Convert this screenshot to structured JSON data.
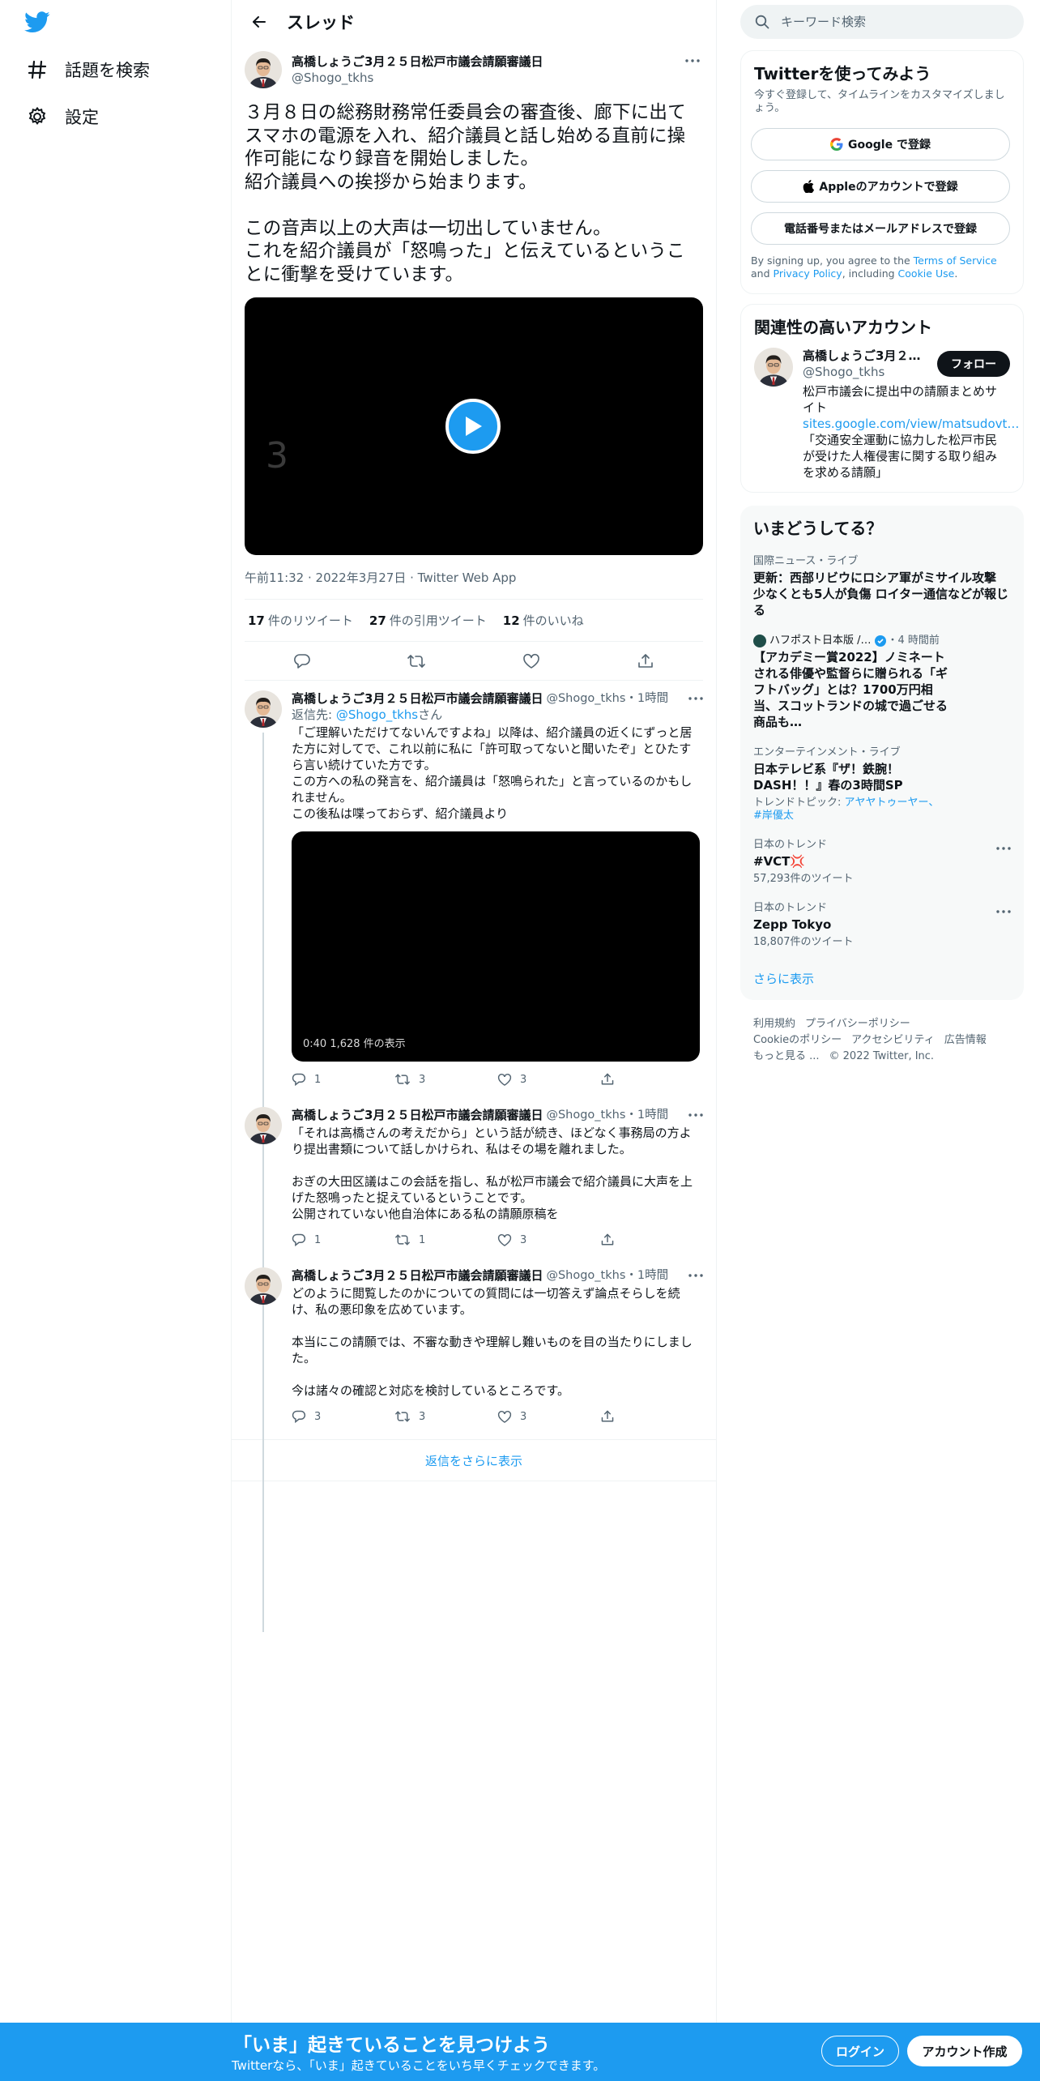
{
  "nav": {
    "logo_icon": "twitter-bird-icon",
    "items": [
      {
        "label": "話題を検索",
        "icon": "hashtag-icon"
      },
      {
        "label": "設定",
        "icon": "gear-icon"
      }
    ]
  },
  "header": {
    "title": "スレッド"
  },
  "tweet": {
    "name": "高橋しょうご3月２５日松戸市議会請願審議日",
    "handle": "@Shogo_tkhs",
    "text": "３月８日の総務財務常任委員会の審査後、廊下に出てスマホの電源を入れ、紹介議員と話し始める直前に操作可能になり録音を開始しました。\n紹介議員への挨拶から始まります。\n\nこの音声以上の大声は一切出していません。\nこれを紹介議員が「怒鳴った」と伝えているということに衝撃を受けています。",
    "video_countdown": "3",
    "meta": "午前11:32 · 2022年3月27日 · Twitter Web App",
    "stats": [
      {
        "count": "17",
        "label": "件のリツイート"
      },
      {
        "count": "27",
        "label": "件の引用ツイート"
      },
      {
        "count": "12",
        "label": "件のいいね"
      }
    ]
  },
  "replies": [
    {
      "name": "高橋しょうご3月２５日松戸市議会請願審議日",
      "handle": "@Shogo_tkhs",
      "time": "・1時間",
      "replying_prefix": "返信先: ",
      "replying_handle": "@Shogo_tkhs",
      "replying_suffix": "さん",
      "text": "「ご理解いただけてないんですよね」以降は、紹介議員の近くにずっと居た方に対してで、これ以前に私に「許可取ってないと聞いたぞ」とひたすら言い続けていた方です。\nこの方への私の発言を、紹介議員は「怒鳴られた」と言っているのかもしれません。\nこの後私は喋っておらず、紹介議員より",
      "video_info": "0:40   1,628 件の表示",
      "counts": {
        "reply": "1",
        "retweet": "3",
        "like": "3"
      }
    },
    {
      "name": "高橋しょうご3月２５日松戸市議会請願審議日",
      "handle": "@Shogo_tkhs",
      "time": "・1時間",
      "text": "「それは高橋さんの考えだから」という話が続き、ほどなく事務局の方より提出書類について話しかけられ、私はその場を離れました。\n\nおぎの大田区議はこの会話を指し、私が松戸市議会で紹介議員に大声を上げた怒鳴ったと捉えているということです。\n公開されていない他自治体にある私の請願原稿を",
      "counts": {
        "reply": "1",
        "retweet": "1",
        "like": "3"
      }
    },
    {
      "name": "高橋しょうご3月２５日松戸市議会請願審議日",
      "handle": "@Shogo_tkhs",
      "time": "・1時間",
      "text": "どのように閲覧したのかについての質問には一切答えず論点そらしを続け、私の悪印象を広めています。\n\n本当にこの請願では、不審な動きや理解し難いものを目の当たりにしました。\n\n今は諸々の確認と対応を検討しているところです。",
      "counts": {
        "reply": "3",
        "retweet": "3",
        "like": "3"
      }
    }
  ],
  "show_more_replies": "返信をさらに表示",
  "search": {
    "placeholder": "キーワード検索"
  },
  "signup": {
    "title": "Twitterを使ってみよう",
    "subtitle": "今すぐ登録して、タイムラインをカスタマイズしましょう。",
    "google": "Google で登録",
    "apple": "Appleのアカウントで登録",
    "phone": "電話番号またはメールアドレスで登録",
    "tos_1": "By signing up, you agree to the ",
    "tos_link1": "Terms of Service",
    "tos_2": " and ",
    "tos_link2": "Privacy Policy",
    "tos_3": ", including ",
    "tos_link3": "Cookie Use",
    "tos_4": "."
  },
  "related": {
    "title": "関連性の高いアカウント",
    "name": "高橋しょうご3月２５日松戸市議会請願審議日",
    "handle": "@Shogo_tkhs",
    "follow": "フォロー",
    "bio_1": "松戸市議会に提出中の請願まとめサイト ",
    "bio_link": "sites.google.com/view/matsudovt…",
    "bio_2": "「交通安全運動に協力した松戸市民が受けた人権侵害に関する取り組みを求める請願」"
  },
  "trends": {
    "title": "いまどうしてる？",
    "items": [
      {
        "category": "国際ニュース・ライブ",
        "title": "更新：西部リビウにロシア軍がミサイル攻撃 少なくとも5人が負傷 ロイター通信などが報じる"
      },
      {
        "source": "ハフポスト日本版 /…",
        "time": "・4 時間前",
        "title": "【アカデミー賞2022】ノミネートされる俳優や監督らに贈られる「ギフトバッグ」とは？1700万円相当、スコットランドの城で過ごせる商品も…"
      },
      {
        "category": "エンターテインメント・ライブ",
        "title": "日本テレビ系『ザ！鉄腕！DASH！！』春の3時間SP",
        "topics_prefix": "トレンドトピック: ",
        "topics": "アヤヤトゥーヤー、#岸優太"
      },
      {
        "category": "日本のトレンド",
        "title": "#VCT💢",
        "count": "57,293件のツイート"
      },
      {
        "category": "日本のトレンド",
        "title": "Zepp Tokyo",
        "count": "18,807件のツイート"
      }
    ],
    "show_more": "さらに表示"
  },
  "footer": {
    "links_row1": [
      "利用規約",
      "プライバシーポリシー"
    ],
    "links_row2": [
      "Cookieのポリシー",
      "アクセシビリティ",
      "広告情報"
    ],
    "more": "もっと見る ...",
    "copyright": "© 2022 Twitter, Inc."
  },
  "bottom_bar": {
    "headline": "「いま」起きていることを見つけよう",
    "sub": "Twitterなら、「いま」起きていることをいち早くチェックできます。",
    "login": "ログイン",
    "signup": "アカウント作成"
  },
  "colors": {
    "accent": "#1d9bf0",
    "text": "#0f1419",
    "muted": "#536471",
    "bar": "#1d9bf0"
  }
}
